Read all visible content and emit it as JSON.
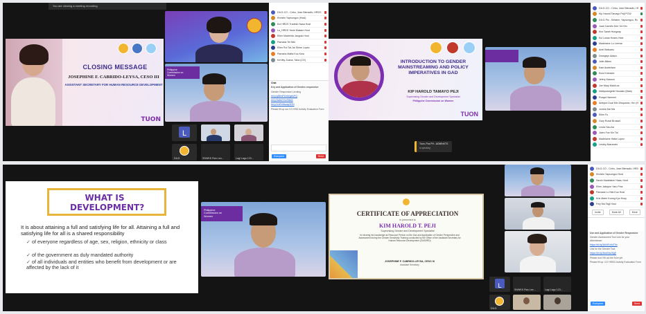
{
  "window": {
    "tab_label": "You are viewing a meeting recording"
  },
  "q1": {
    "slide": {
      "title": "CLOSING MESSAGE",
      "speaker": "JOSEPHINE F. CABRIDO-LEYSA, CESO III",
      "position": "ASSISTANT SECRETARY FOR HUMAN RESOURCE DEVELOPMENT",
      "brand": "TUON"
    },
    "pcw_banner": "Philippine Commission on Women",
    "thumbs": {
      "t1_letter": "L",
      "t1_label": "",
      "t3_label": "DILG",
      "t4_label": "SNWKK Ran Leo...",
      "t5_label": "Lagi Lagu 123..."
    },
    "participants": [
      "DILG-CO - Cebu, Jose Bienadlo, HRDS",
      "Khristin Yapsungco (Host)",
      "Eul HRDS Tradesh Nasa Host",
      "Lu_HRDS Yoshi Makam Host",
      "Ellen Madiehta Jaoguio Host",
      "Pamada Tei Niki",
      "Ellen Roi Tal-Jai Shine Lopez",
      "Pamana Matta Kuo Kwa",
      "KeVitty Zoana, Tana (CO)"
    ],
    "chat": {
      "header": "Chat",
      "messages": [
        "Key and Application of Gender-responsive",
        "Gender Responsive Lending",
        "bit.ly/q58mPDwWgelsPQ",
        "bit.ly/3s8dGVwStfAi0",
        "bit.ly/3/dFeMswqr5GN",
        "Please fill up our CO HRD Activity Evaluation Form",
        "Everyone"
      ],
      "send_label": "Send"
    }
  },
  "q2": {
    "slide": {
      "title": "INTRODUCTION TO GENDER MAINSTREAMING AND POLICY IMPERATIVES IN GAD",
      "speaker": "KIP HAROLD TAMAYO PEJI",
      "position": "Supervising Gender and Development Specialist",
      "org": "Philippine Commission on Women",
      "brand": "TUON"
    },
    "status_popup": {
      "name": "Tuon, Pos PH - ADMINKTS",
      "sub": "is speaking"
    },
    "participants": [
      "DILG-CO - Cebu, Jose Bienadlo, HRDS",
      "Kip Harold Tamayo Peji PCW",
      "DILG-Pio - Kirtalen, Yapsungco, Rc Kzu",
      "Juan Camillo Dee Ya Kim",
      "Kim Sarah Hungcay",
      "Eul Lukas Hoses Host",
      "Madelaine Lo Leema",
      "Ariel Belisario",
      "Deanjayn Adara",
      "Jolie Aitken",
      "Kaie Anderlson",
      "Eula Kobrazin",
      "Jefery Kasson",
      "Joe Mary MaxiLoa",
      "Nelaysiangelie Nocasio (Maa)",
      "Roaya Hammel",
      "Antique-Dual Min Disquanio, Hrn (HR)",
      "Jonela Dai Ma",
      "Ellen Fu",
      "Gary Rosal Brosani",
      "Leota Hau Aa",
      "Jalen Foe Kin Tai",
      "Madelaine Hatta Lopez",
      "Lesley Akaranzin"
    ]
  },
  "q3": {
    "slide": {
      "title": "WHAT IS DEVELOPMENT?",
      "intro": "It is about attaining a full and satisfying life for all. Attaining a full and satisfying life for all is a shared responsibility",
      "bullets": [
        "of everyone regardless of age, sex, religion, ethnicity or class",
        "of the government as duly mandated authority",
        "of all individuals and entities who benefit from development or are affected by the lack of it"
      ]
    },
    "pcw_banner": "Philippine Commission on Women"
  },
  "q4": {
    "certificate": {
      "heading": "CERTIFICATE OF APPRECIATION",
      "given_to": "is presented to",
      "recipient": "KIM HAROLD T. PEJI",
      "recipient_title": "Supervising Gender and Development Specialist",
      "body": "for sharing his knowledge as Resource Person on the Use and Application of Gender Perspective and Assessment during the Gender Sensitivity Training conducted by the Office of the Assistant Secretary for Human Resource Development (OASHRD)",
      "signatory": "JOSEPHINE F. CABRIDO-LEYSA, CESO III",
      "signatory_title": "Assistant Secretary"
    },
    "thumbs": {
      "t1_letter": "L",
      "t1_label": "",
      "t2_label": "SNWKK Ran Lee...",
      "t3_label": "Lagi Lagu 123...",
      "t4_label": "DILG",
      "t5_label": "",
      "t6_label": ""
    },
    "participants": [
      "DILG-CO - Cebu, Jose Bienadlo, HRDS",
      "Khristin Yapsungco Host",
      "Sarah Madelaine Hasa, Host",
      "Ellen Jaksyne Yaru Pine",
      "Pamada Lo Niki Kuo Host",
      "Kris Marie Kunng Kyo Hosy",
      "Fely Ma Tagi Host"
    ],
    "buttons": {
      "invite": "Invite",
      "mute_all": "Mute All",
      "more": "More"
    },
    "chat": {
      "messages": [
        "Use and Application of Gender Responsive",
        "Gender Assessment Tool Link for your Attendance:",
        "https://bit.ly/3Ah5FcKdT5n",
        "Link for the Gender Tool:",
        "https://bit.ly/3kmEbsJ9gE",
        "Please don't fill out the form yet",
        "Please fill up: CO HRDD Activity Evaluation Form",
        "Everyone"
      ],
      "send_label": "Send"
    }
  }
}
